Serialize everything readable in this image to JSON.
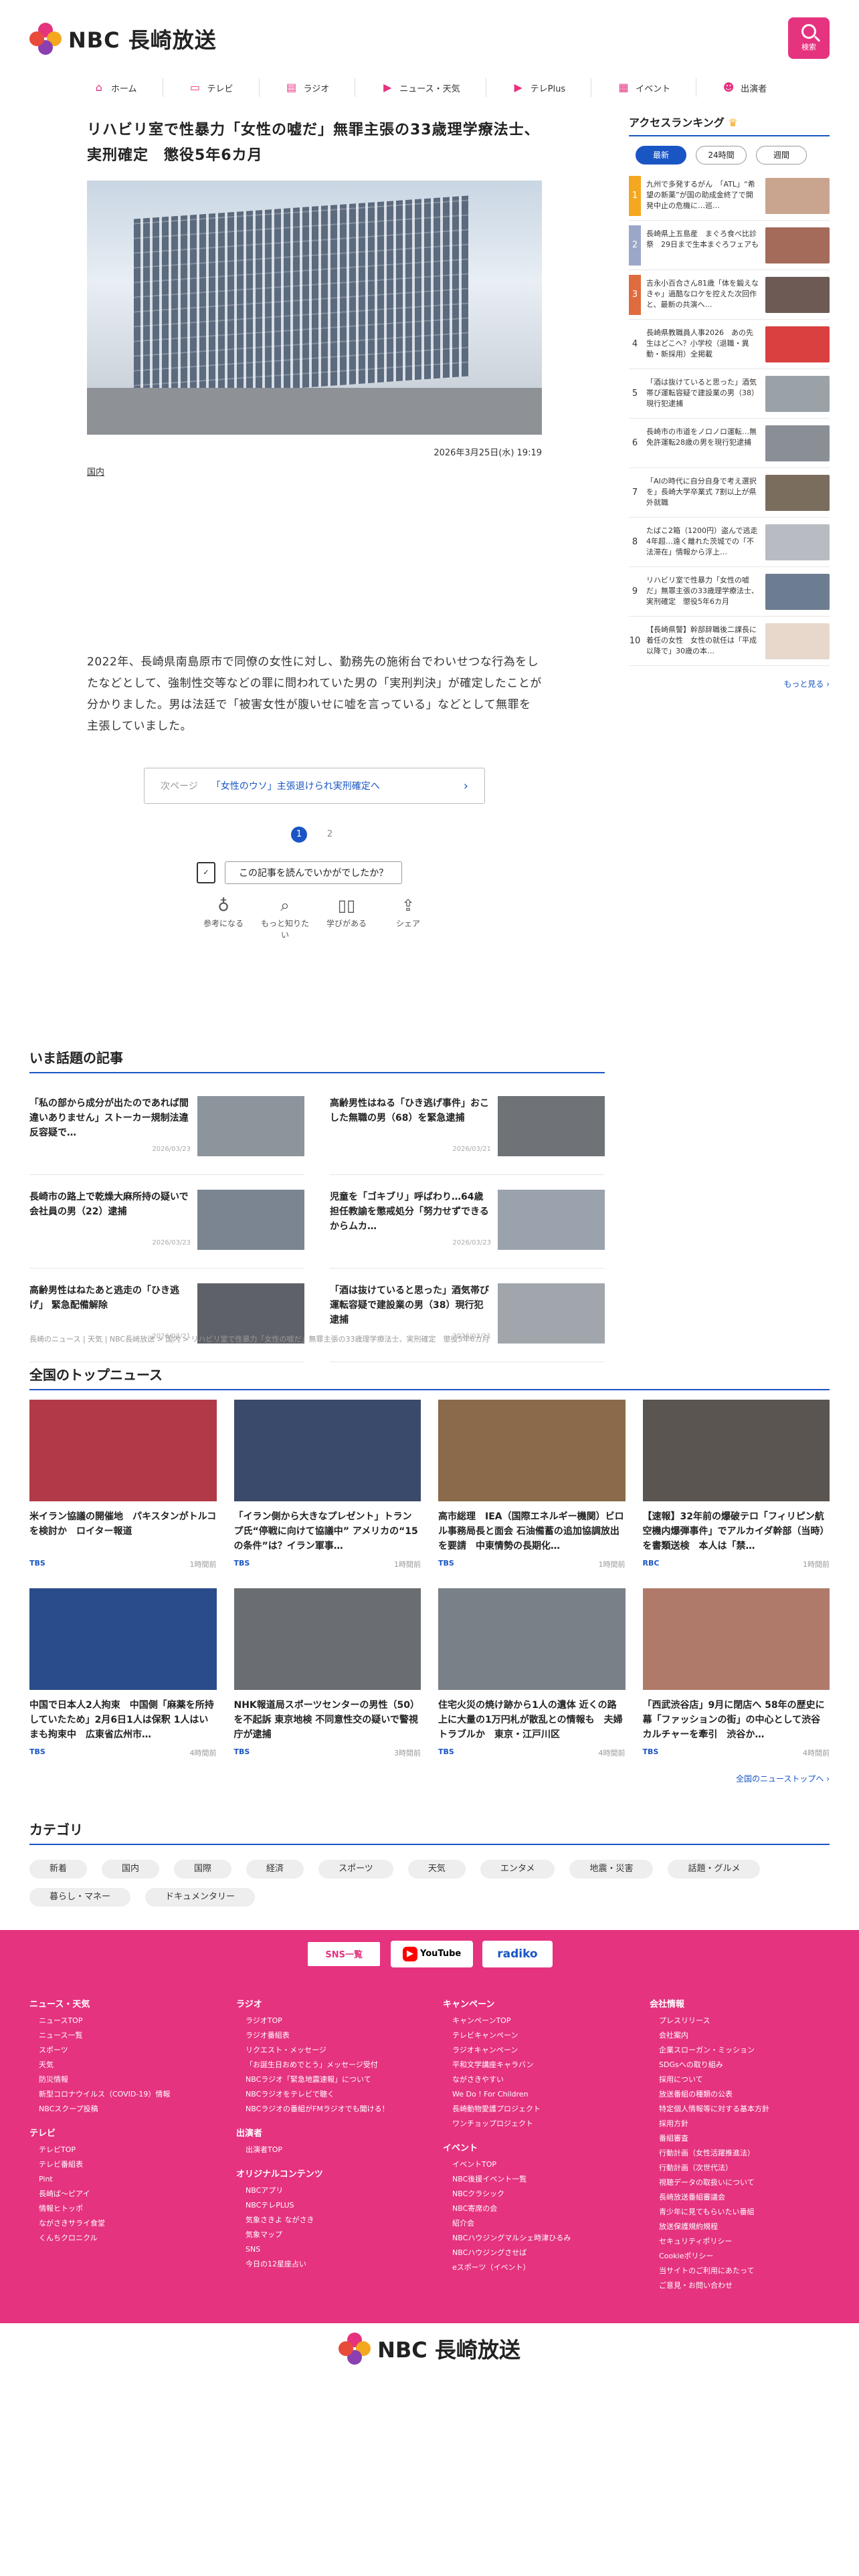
{
  "header": {
    "logo_text": "NBC 長崎放送",
    "search_label": "検索"
  },
  "nav": [
    {
      "label": "ホーム",
      "icon": "home-icon",
      "glyph": "⌂"
    },
    {
      "label": "テレビ",
      "icon": "tv-icon",
      "glyph": "▭"
    },
    {
      "label": "ラジオ",
      "icon": "radio-icon",
      "glyph": "▤"
    },
    {
      "label": "ニュース・天気",
      "icon": "news-icon",
      "glyph": "▶"
    },
    {
      "label": "テレPlus",
      "icon": "teleplus-icon",
      "glyph": "▶"
    },
    {
      "label": "イベント",
      "icon": "calendar-icon",
      "glyph": "▦"
    },
    {
      "label": "出演者",
      "icon": "people-icon",
      "glyph": "☻"
    }
  ],
  "article": {
    "title": "リハビリ室で性暴力「女性の嘘だ」無罪主張の33歳理学療法士、実刑確定　懲役5年6カ月",
    "date": "2026年3月25日(水) 19:19",
    "category": "国内",
    "body": "2022年、長崎県南島原市で同僚の女性に対し、勤務先の施術台でわいせつな行為をしたなどとして、強制性交等などの罪に問われていた男の「実刑判決」が確定したことが分かりました。男は法廷で「被害女性が腹いせに嘘を言っている」などとして無罪を主張していました。",
    "next_label": "次ページ",
    "next_text": "「女性のウソ」主張退けられ実刑確定へ",
    "pages": [
      "1",
      "2"
    ],
    "feedback_question": "この記事を読んでいかがでしたか？",
    "reactions": [
      {
        "label": "参考になる",
        "icon": "lightbulb-icon",
        "glyph": "♁"
      },
      {
        "label": "もっと知りたい",
        "icon": "search-icon",
        "glyph": "⌕"
      },
      {
        "label": "学びがある",
        "icon": "book-icon",
        "glyph": "▯▯"
      },
      {
        "label": "シェア",
        "icon": "share-icon",
        "glyph": "⇪"
      }
    ]
  },
  "ranking": {
    "title": "アクセスランキング",
    "tabs": [
      "最新",
      "24時間",
      "週間"
    ],
    "items": [
      {
        "n": "1",
        "text": "九州で多発するがん　「ATL」“希望の新薬”が国の助成金終了で開発中止の危機に…巡…",
        "color": "#c9a58f"
      },
      {
        "n": "2",
        "text": "長崎県上五島産　まぐろ食べ比診祭　29日まで生本まぐろフェアも",
        "color": "#a46a5a"
      },
      {
        "n": "3",
        "text": "吉永小百合さん81歳「体を鍛えなきゃ」過酷なロケを控えた次回作と、最新の共演へ…",
        "color": "#6d5a55"
      },
      {
        "n": "4",
        "text": "長崎県教職員人事2026　あの先生はどこへ？小学校（退職・異動・新採用）全掲載",
        "color": "#d94040"
      },
      {
        "n": "5",
        "text": "「酒は抜けていると思った」酒気帯び運転容疑で建設業の男（38）現行犯逮捕",
        "color": "#9aa2a8"
      },
      {
        "n": "6",
        "text": "長崎市の市道をノロノロ運転…無免許運転28歳の男を現行犯逮捕",
        "color": "#8a8f96"
      },
      {
        "n": "7",
        "text": "「AIの時代に自分自身で考え選択を」長崎大学卒業式 7割以上が県外就職",
        "color": "#7a6d5e"
      },
      {
        "n": "8",
        "text": "たばこ2箱（1200円）盗んで逃走4年超…遠く離れた茨城での「不法滞在」情報から浮上…",
        "color": "#b8bcc2"
      },
      {
        "n": "9",
        "text": "リハビリ室で性暴力「女性の嘘だ」無罪主張の33歳理学療法士、実刑確定　懲役5年6カ月",
        "color": "#6d7d91"
      },
      {
        "n": "10",
        "text": "【長崎県警】幹部辞職後二課長に着任の女性　女性の就任は「平成以降で」30歳の本…",
        "color": "#e8d8cc"
      }
    ],
    "more": "もっと見る ›"
  },
  "trending": {
    "title": "いま話題の記事",
    "items": [
      {
        "title": "「私の部から成分が出たのであれば間違いありません」ストーカー規制法違反容疑で…",
        "date": "2026/03/23",
        "color": "#8c949c"
      },
      {
        "title": "高齢男性はねる「ひき逃げ事件」おこした無職の男（68）を緊急逮捕",
        "date": "2026/03/21",
        "color": "#6f7378"
      },
      {
        "title": "長崎市の路上で乾燥大麻所持の疑いで会社員の男（22）逮捕",
        "date": "2026/03/23",
        "color": "#7b8591"
      },
      {
        "title": "児童を「ゴキブリ」呼ばわり…64歳担任教諭を懲戒処分「努力せずできるからムカ…",
        "date": "2026/03/23",
        "color": "#9aa3ad"
      },
      {
        "title": "高齢男性はねたあと逃走の「ひき逃げ」 緊急配備解除",
        "date": "2026/03/21",
        "color": "#5e6168"
      },
      {
        "title": "「酒は抜けていると思った」酒気帯び運転容疑で建設業の男（38）現行犯逮捕",
        "date": "2026/03/21",
        "color": "#a0a6ac"
      }
    ]
  },
  "breadcrumb": "長崎のニュース | 天気 | NBC長崎放送 > 国内 > リハビリ室で性暴力「女性の嘘だ」無罪主張の33歳理学療法士、実刑確定　懲役5年6カ月",
  "topnews": {
    "title": "全国のトップニュース",
    "items": [
      {
        "title": "米イラン協議の開催地　パキスタンがトルコを検討か　ロイター報道",
        "src": "TBS",
        "time": "1時間前",
        "color": "#b23a48"
      },
      {
        "title": "「イラン側から大きなプレゼント」トランプ氏“停戦に向けて協議中” アメリカの“15の条件”は？イラン軍事…",
        "src": "TBS",
        "time": "1時間前",
        "color": "#3a4a6a"
      },
      {
        "title": "高市総理　IEA（国際エネルギー機関）ビロル事務局長と面会 石油備蓄の追加協調放出を要請　中東情勢の長期化…",
        "src": "TBS",
        "time": "1時間前",
        "color": "#8a6a4a"
      },
      {
        "title": "【速報】32年前の爆破テロ「フィリピン航空機内爆弾事件」でアルカイダ幹部（当時）を書類送検　本人は「禁…",
        "src": "RBC",
        "time": "1時間前",
        "color": "#5a5550"
      },
      {
        "title": "中国で日本人2人拘束　中国側「麻薬を所持していたため」2月6日1人は保釈 1人はいまも拘束中　広東省広州市…",
        "src": "TBS",
        "time": "4時間前",
        "color": "#2a4c8a"
      },
      {
        "title": "NHK報道局スポーツセンターの男性（50）を不起訴 東京地検 不同意性交の疑いで警視庁が逮捕",
        "src": "TBS",
        "time": "3時間前",
        "color": "#6a6e72"
      },
      {
        "title": "住宅火災の焼け跡から1人の遺体 近くの路上に大量の1万円札が散乱との情報も　夫婦トラブルか　東京・江戸川区",
        "src": "TBS",
        "time": "4時間前",
        "color": "#7a8088"
      },
      {
        "title": "「西武渋谷店」9月に閉店へ 58年の歴史に幕「ファッションの街」の中心として渋谷カルチャーを牽引　渋谷か…",
        "src": "TBS",
        "time": "4時間前",
        "color": "#b07a6a"
      }
    ],
    "more": "全国のニューストップへ ›"
  },
  "categories": {
    "title": "カテゴリ",
    "items": [
      "新着",
      "国内",
      "国際",
      "経済",
      "スポーツ",
      "天気",
      "エンタメ",
      "地震・災害",
      "話題・グルメ",
      "暮らし・マネー",
      "ドキュメンタリー"
    ]
  },
  "footer": {
    "btn_sns": "SNS一覧",
    "btn_youtube": "YouTube",
    "btn_radiko": "radiko",
    "columns": [
      {
        "groups": [
          {
            "title": "ニュース・天気",
            "links": [
              "ニュースTOP",
              "ニュース一覧",
              "スポーツ",
              "天気",
              "防災情報",
              "新型コロナウイルス（COVID-19）情報",
              "NBCスクープ投稿"
            ]
          },
          {
            "title": "テレビ",
            "links": [
              "テレビTOP",
              "テレビ番組表",
              "Pint",
              "長崎ば～ピアイ",
              "情報ヒトッポ",
              "ながさきサライ食堂",
              "くんちクロニクル"
            ]
          }
        ]
      },
      {
        "groups": [
          {
            "title": "ラジオ",
            "links": [
              "ラジオTOP",
              "ラジオ番組表",
              "リクエスト・メッセージ",
              "「お誕生日おめでとう」メッセージ受付",
              "NBCラジオ「緊急地震速報」について",
              "NBCラジオをテレビで聴く",
              "NBCラジオの番組がFMラジオでも聞ける！"
            ]
          },
          {
            "title": "出演者",
            "links": [
              "出演者TOP"
            ]
          },
          {
            "title": "オリジナルコンテンツ",
            "links": [
              "NBCアプリ",
              "NBCテレPLUS",
              "気象さきよ ながさき",
              "気象マップ",
              "SNS",
              "今日の12星座占い"
            ]
          }
        ]
      },
      {
        "groups": [
          {
            "title": "キャンペーン",
            "links": [
              "キャンペーンTOP",
              "テレビキャンペーン",
              "ラジオキャンペーン",
              "平和文学講座キャラバン",
              "ながさきやすい",
              "We Do ! For Children",
              "長崎動物愛護プロジェクト",
              "ワンチョップロジェクト"
            ]
          },
          {
            "title": "イベント",
            "links": [
              "イベントTOP",
              "NBC後援イベント一覧",
              "NBCクラシック",
              "NBC寄席の会",
              "紹介会",
              "NBCハウジングマルシェ時津ひるみ",
              "NBCハウジングさせば",
              "eスポーツ（イベント）"
            ]
          }
        ]
      },
      {
        "groups": [
          {
            "title": "会社情報",
            "links": [
              "プレスリリース",
              "会社案内",
              "企業スローガン・ミッション",
              "SDGsへの取り組み",
              "採用について",
              "放送番組の種類の公表",
              "特定個人情報等に対する基本方針",
              "採用方針",
              "番組審査",
              "行動計画（女性活躍推進法）",
              "行動計画（次世代法）",
              "視聴データの取扱いについて",
              "長崎放送番組審議会",
              "青少年に見てもらいたい番組",
              "放送保護規約規程",
              "セキュリティポリシー",
              "Cookieポリシー",
              "当サイトのご利用にあたって",
              "ご意見・お問い合わせ"
            ]
          }
        ]
      }
    ]
  }
}
